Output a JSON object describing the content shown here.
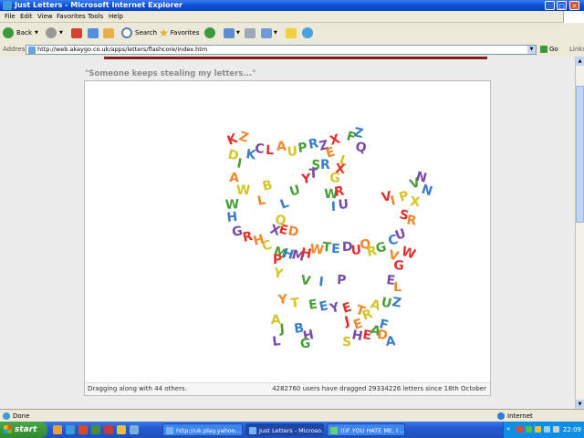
{
  "window": {
    "title": "Just Letters - Microsoft Internet Explorer",
    "min": "_",
    "max": "□",
    "close": "✕"
  },
  "menu": [
    "File",
    "Edit",
    "View",
    "Favorites",
    "Tools",
    "Help"
  ],
  "toolbar": {
    "back": "Back",
    "search": "Search",
    "favorites": "Favorites"
  },
  "address": {
    "label": "Address",
    "url": "http://web.akaygo.co.uk/apps/letters/flashcore/index.htm",
    "go": "Go",
    "links": "Links"
  },
  "page": {
    "subtitle": "\"Someone keeps stealing my letters...\"",
    "footer_left": "Dragging along with 44 others.",
    "footer_right": "4282760 users have dragged 29334226 letters since 18th October"
  },
  "colors": {
    "red": "#e0312f",
    "orange": "#ef8a2c",
    "yellow": "#d6c62a",
    "green": "#4a9e3a",
    "blue": "#3a7fc8",
    "purple": "#7a4aa8"
  },
  "status": {
    "text": "Done",
    "zone": "Internet"
  },
  "taskbar": {
    "start": "start",
    "tasks": [
      "http://uk.play.yahoo....",
      "Just Letters - Microso...",
      "((IF YOU HATE ME, I ..."
    ],
    "clock": "22:09"
  }
}
